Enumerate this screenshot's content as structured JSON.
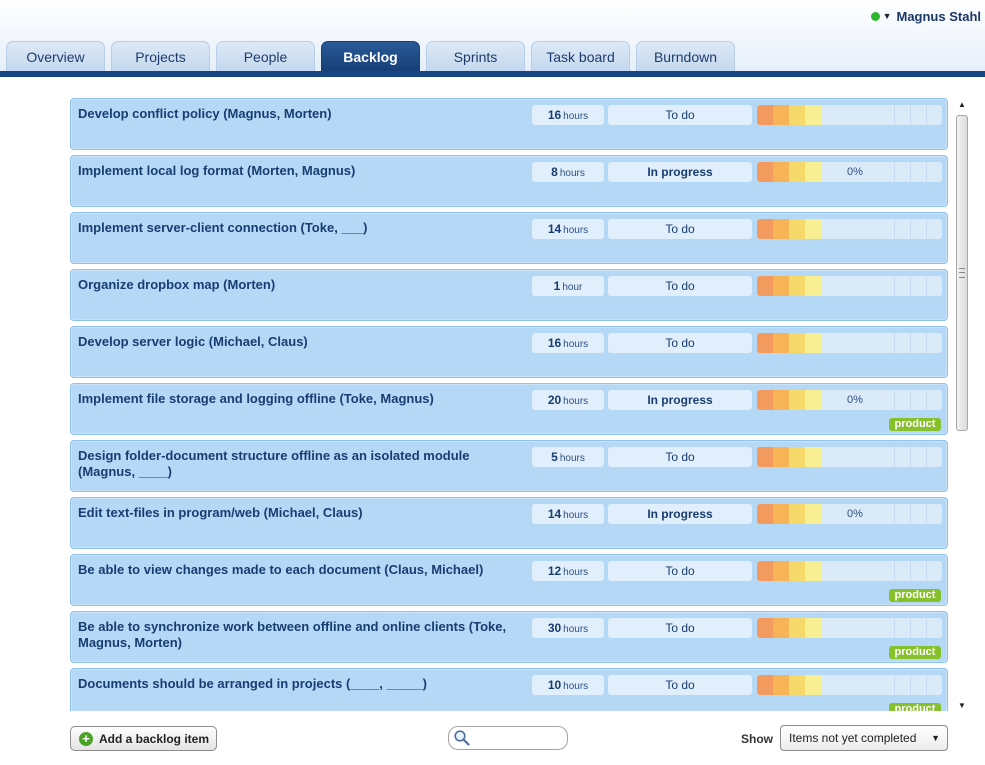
{
  "user": {
    "name": "Magnus Stahl",
    "status_color": "#2db52d"
  },
  "tabs": [
    {
      "label": "Overview",
      "active": false
    },
    {
      "label": "Projects",
      "active": false
    },
    {
      "label": "People",
      "active": false
    },
    {
      "label": "Backlog",
      "active": true
    },
    {
      "label": "Sprints",
      "active": false
    },
    {
      "label": "Task board",
      "active": false
    },
    {
      "label": "Burndown",
      "active": false
    }
  ],
  "backlog": [
    {
      "title": "Develop conflict policy (Magnus, Morten)",
      "hours": "16",
      "unit": "hours",
      "status": "To do",
      "progress": "",
      "badge": ""
    },
    {
      "title": "Implement local log format (Morten, Magnus)",
      "hours": "8",
      "unit": "hours",
      "status": "In progress",
      "progress": "0%",
      "badge": ""
    },
    {
      "title": "Implement server-client connection (Toke, ___)",
      "hours": "14",
      "unit": "hours",
      "status": "To do",
      "progress": "",
      "badge": ""
    },
    {
      "title": "Organize dropbox map (Morten)",
      "hours": "1",
      "unit": "hour",
      "status": "To do",
      "progress": "",
      "badge": ""
    },
    {
      "title": "Develop server logic (Michael, Claus)",
      "hours": "16",
      "unit": "hours",
      "status": "To do",
      "progress": "",
      "badge": ""
    },
    {
      "title": "Implement file storage and logging offline (Toke, Magnus)",
      "hours": "20",
      "unit": "hours",
      "status": "In progress",
      "progress": "0%",
      "badge": "product"
    },
    {
      "title": "Design folder-document structure offline as an isolated module (Magnus, ____)",
      "hours": "5",
      "unit": "hours",
      "status": "To do",
      "progress": "",
      "badge": ""
    },
    {
      "title": "Edit text-files in program/web (Michael, Claus)",
      "hours": "14",
      "unit": "hours",
      "status": "In progress",
      "progress": "0%",
      "badge": ""
    },
    {
      "title": "Be able to view changes made to each document (Claus, Michael)",
      "hours": "12",
      "unit": "hours",
      "status": "To do",
      "progress": "",
      "badge": "product"
    },
    {
      "title": "Be able to synchronize work between offline and online clients (Toke, Magnus, Morten)",
      "hours": "30",
      "unit": "hours",
      "status": "To do",
      "progress": "",
      "badge": "product"
    },
    {
      "title": "Documents should be arranged in projects (____, _____)",
      "hours": "10",
      "unit": "hours",
      "status": "To do",
      "progress": "",
      "badge": "product"
    }
  ],
  "footer": {
    "add_label": "Add a backlog item",
    "search_placeholder": "",
    "show_label": "Show",
    "filter_value": "Items not yet completed"
  },
  "colors": {
    "accent": "#164583",
    "item_bg": "#b6d8f7",
    "badge": "#86c02a"
  }
}
